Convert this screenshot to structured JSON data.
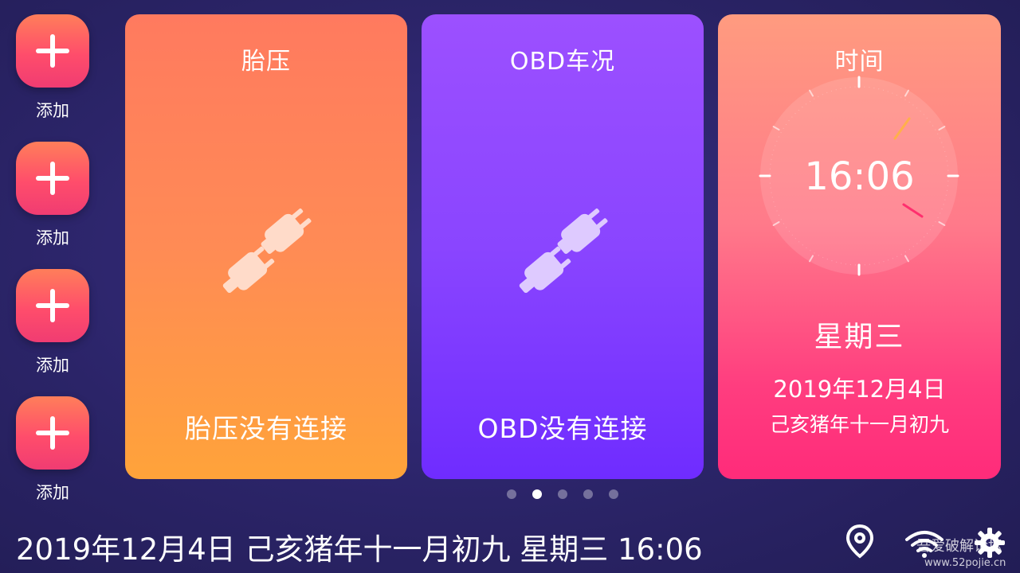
{
  "sidebar": {
    "add_items": [
      {
        "label": "添加"
      },
      {
        "label": "添加"
      },
      {
        "label": "添加"
      },
      {
        "label": "添加"
      }
    ]
  },
  "cards": {
    "tire": {
      "title": "胎压",
      "status": "胎压没有连接",
      "icon": "plug-disconnected-icon"
    },
    "obd": {
      "title": "OBD车况",
      "status": "OBD没有连接",
      "icon": "plug-disconnected-icon"
    },
    "time": {
      "title": "时间",
      "clock_time": "16:06",
      "weekday": "星期三",
      "date": "2019年12月4日",
      "lunar": "己亥猪年十一月初九"
    }
  },
  "pager": {
    "count": 5,
    "active_index": 1
  },
  "bottom_bar": {
    "status_text": "2019年12月4日 己亥猪年十一月初九 星期三 16:06",
    "icons": [
      "location-pin-icon",
      "wifi-icon",
      "gear-icon"
    ],
    "watermark": "吾爱破解论坛",
    "watermark_url": "www.52pojie.cn"
  },
  "colors": {
    "background": "#2b2468",
    "tire_card": "#ff8b55",
    "obd_card": "#8a45ff",
    "time_card": "#ff5a80",
    "add_button": "#ff4d6b"
  }
}
